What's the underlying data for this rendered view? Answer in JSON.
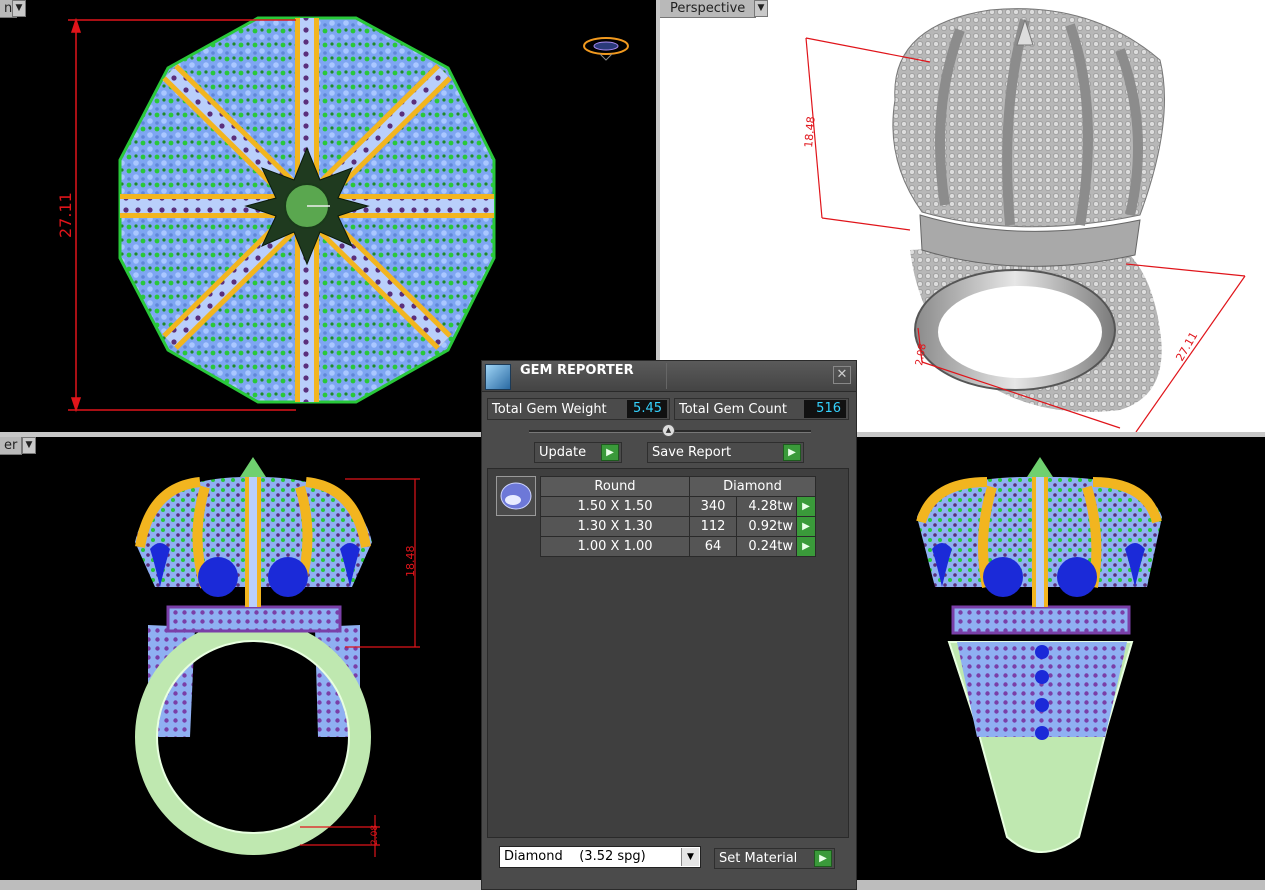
{
  "viewports": {
    "top_left": {
      "label": "n"
    },
    "top_right": {
      "label": "Perspective"
    },
    "bottom_left": {
      "label": "er"
    },
    "dims": {
      "top_width": "27.11",
      "persp_height": "18.48",
      "persp_width": "27.11",
      "persp_small": "2.08",
      "front_height": "18.48",
      "front_small": "2.08"
    }
  },
  "gem_reporter": {
    "title": "GEM REPORTER",
    "close_icon": "close-icon",
    "total_gem_weight_label": "Total Gem Weight",
    "total_gem_weight": "5.45",
    "total_gem_count_label": "Total Gem Count",
    "total_gem_count": "516",
    "update_label": "Update",
    "save_report_label": "Save Report",
    "table": {
      "shape": "Round",
      "material": "Diamond",
      "rows": [
        {
          "size": "1.50 X 1.50",
          "count": "340",
          "weight": "4.28tw"
        },
        {
          "size": "1.30 X 1.30",
          "count": "112",
          "weight": "0.92tw"
        },
        {
          "size": "1.00 X 1.00",
          "count": "64",
          "weight": "0.24tw"
        }
      ]
    },
    "material_select": "Diamond    (3.52 spg)",
    "set_material_label": "Set Material"
  },
  "colors": {
    "accent_green": "#3a9a3a",
    "value_cyan": "#34d3ff",
    "dimension_red": "#e0141a",
    "gold": "#f2b51f",
    "stone_blue": "#7ea6f2",
    "stone_green": "#29c83a"
  }
}
